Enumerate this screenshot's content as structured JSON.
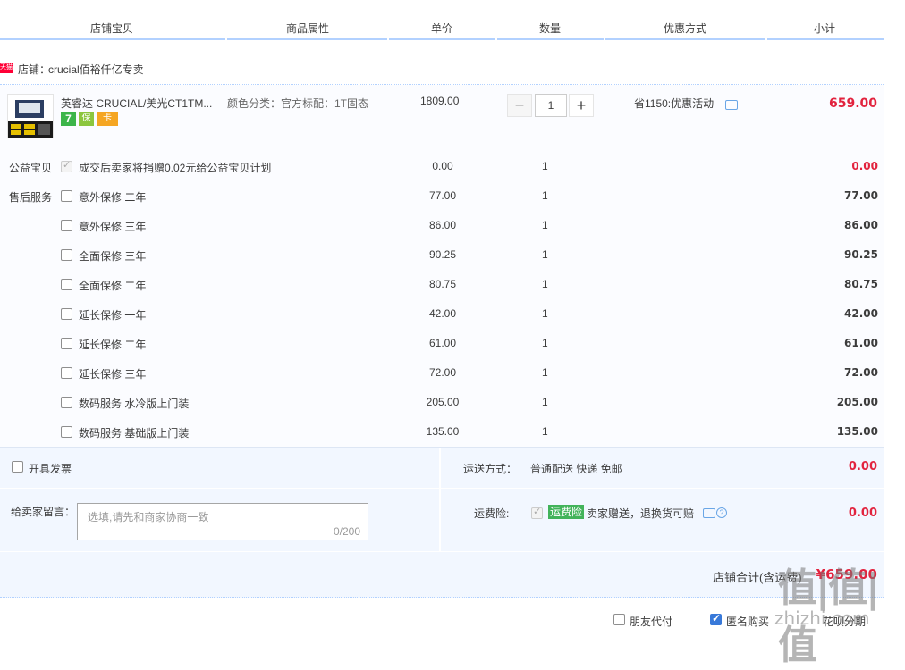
{
  "header": {
    "columns": [
      "店铺宝贝",
      "商品属性",
      "单价",
      "数量",
      "优惠方式",
      "小计"
    ]
  },
  "shop": {
    "badge": "天猫",
    "label": "店铺：",
    "name": "crucial佰裕仟亿专卖"
  },
  "item": {
    "title": "英睿达 CRUCIAL/美光CT1TM...",
    "attr": "颜色分类：官方标配：1T固态",
    "price": "1809.00",
    "quantity": "1",
    "minus": "−",
    "plus": "+",
    "promo": "省1150:优惠活动",
    "subtotal": "659.00",
    "badges": [
      "7",
      "保",
      "卡"
    ]
  },
  "charity": {
    "label": "公益宝贝",
    "text": "成交后卖家将捐赠0.02元给公益宝贝计划",
    "price": "0.00",
    "qty": "1",
    "subtotal": "0.00"
  },
  "after_sales": {
    "label": "售后服务",
    "items": [
      {
        "name": "意外保修 二年",
        "price": "77.00",
        "qty": "1",
        "subtotal": "77.00"
      },
      {
        "name": "意外保修 三年",
        "price": "86.00",
        "qty": "1",
        "subtotal": "86.00"
      },
      {
        "name": "全面保修 三年",
        "price": "90.25",
        "qty": "1",
        "subtotal": "90.25"
      },
      {
        "name": "全面保修 二年",
        "price": "80.75",
        "qty": "1",
        "subtotal": "80.75"
      },
      {
        "name": "延长保修 一年",
        "price": "42.00",
        "qty": "1",
        "subtotal": "42.00"
      },
      {
        "name": "延长保修 二年",
        "price": "61.00",
        "qty": "1",
        "subtotal": "61.00"
      },
      {
        "name": "延长保修 三年",
        "price": "72.00",
        "qty": "1",
        "subtotal": "72.00"
      },
      {
        "name": "数码服务 水冷版上门装",
        "price": "205.00",
        "qty": "1",
        "subtotal": "205.00"
      },
      {
        "name": "数码服务 基础版上门装",
        "price": "135.00",
        "qty": "1",
        "subtotal": "135.00"
      }
    ]
  },
  "invoice": {
    "label": "开具发票"
  },
  "shipping": {
    "label": "运送方式：",
    "method": "普通配送 快递 免邮",
    "price": "0.00"
  },
  "message": {
    "label": "给卖家留言：",
    "placeholder": "选填,请先和商家协商一致",
    "counter": "0/200"
  },
  "insurance": {
    "label": "运费险:",
    "badge": "运费险",
    "text": "卖家赠送，退换货可赔",
    "price": "0.00"
  },
  "total": {
    "label": "店铺合计(含运费)",
    "amount": "¥659.00"
  },
  "footer": {
    "friend_pay": "朋友代付",
    "anonymous": "匿名购买",
    "installment": "花呗分期"
  },
  "watermark": {
    "logo": "值|值|值",
    "text": "zhizhi.com"
  },
  "colors": {
    "price_red": "#e2233e",
    "header_line": "#b2d1ff",
    "panel_bg": "#f2f7ff",
    "checkbox_on": "#3879d9",
    "insurance_green": "#42b35a"
  }
}
